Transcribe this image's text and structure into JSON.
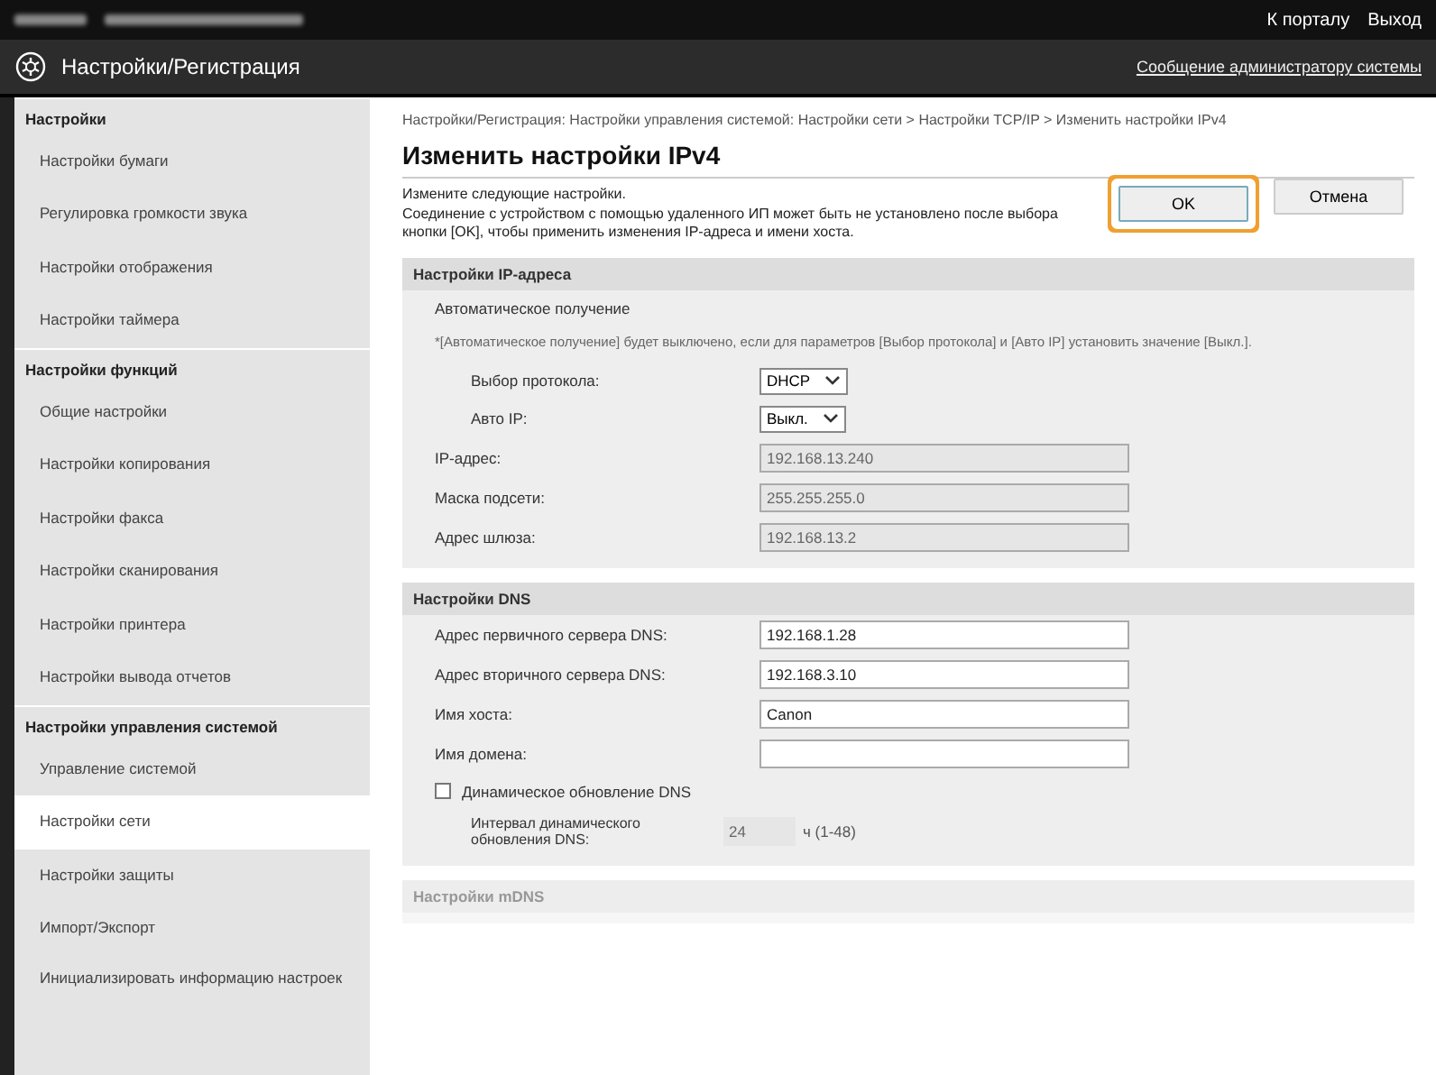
{
  "top_bar": {
    "links": [
      "К порталу",
      "Выход"
    ]
  },
  "header": {
    "title": "Настройки/Регистрация",
    "link": "Сообщение администратору системы"
  },
  "sidebar": {
    "groups": [
      {
        "title": "Настройки",
        "items": [
          {
            "label": "Настройки бумаги",
            "selected": false
          },
          {
            "label": "Регулировка громкости звука",
            "selected": false
          },
          {
            "label": "Настройки отображения",
            "selected": false
          },
          {
            "label": "Настройки таймера",
            "selected": false
          }
        ]
      },
      {
        "title": "Настройки функций",
        "items": [
          {
            "label": "Общие настройки",
            "selected": false
          },
          {
            "label": "Настройки копирования",
            "selected": false
          },
          {
            "label": "Настройки факса",
            "selected": false
          },
          {
            "label": "Настройки сканирования",
            "selected": false
          },
          {
            "label": "Настройки принтера",
            "selected": false
          },
          {
            "label": "Настройки вывода отчетов",
            "selected": false
          }
        ]
      },
      {
        "title": "Настройки управления системой",
        "items": [
          {
            "label": "Управление системой",
            "selected": false
          },
          {
            "label": "Настройки сети",
            "selected": true
          },
          {
            "label": "Настройки защиты",
            "selected": false
          },
          {
            "label": "Импорт/Экспорт",
            "selected": false
          },
          {
            "label": "Инициализировать информацию настроек",
            "selected": false
          }
        ]
      }
    ]
  },
  "breadcrumb": "Настройки/Регистрация: Настройки управления системой: Настройки сети > Настройки TCP/IP > Изменить настройки IPv4",
  "title": "Изменить настройки IPv4",
  "description": [
    "Измените следующие настройки.",
    "Соединение с устройством с помощью удаленного ИП может быть не установлено после выбора кнопки [OK], чтобы применить изменения IP-адреса и имени хоста."
  ],
  "buttons": [
    {
      "label": "OK",
      "highlighted": true
    },
    {
      "label": "Отмена",
      "highlighted": false
    }
  ],
  "sections": [
    {
      "title": "Настройки IP-адреса",
      "rows": [
        {
          "kind": "subheading",
          "label": "Автоматическое получение"
        },
        {
          "kind": "note",
          "label": "*[Автоматическое получение] будет выключено, если для параметров [Выбор протокола] и [Авто IP] установить значение [Выкл.]."
        },
        {
          "kind": "select",
          "label": "Выбор протокола:",
          "value": "DHCP",
          "indent": true
        },
        {
          "kind": "select",
          "label": "Авто IP:",
          "value": "Выкл.",
          "indent": true
        },
        {
          "kind": "readonly",
          "label": "IP-адрес:",
          "value": "192.168.13.240"
        },
        {
          "kind": "readonly",
          "label": "Маска подсети:",
          "value": "255.255.255.0"
        },
        {
          "kind": "readonly",
          "label": "Адрес шлюза:",
          "value": "192.168.13.2"
        }
      ]
    },
    {
      "title": "Настройки DNS",
      "rows": [
        {
          "kind": "text",
          "label": "Адрес первичного сервера DNS:",
          "value": "192.168.1.28"
        },
        {
          "kind": "text",
          "label": "Адрес вторичного сервера DNS:",
          "value": "192.168.3.10"
        },
        {
          "kind": "text",
          "label": "Имя хоста:",
          "value": "Canon"
        },
        {
          "kind": "text",
          "label": "Имя домена:"
        },
        {
          "kind": "checkbox",
          "label": "Динамическое обновление DNS",
          "checked": false
        },
        {
          "kind": "small",
          "label": "Интервал динамического обновления DNS:",
          "value": "24",
          "unit": "ч (1-48)",
          "indent": true
        }
      ]
    },
    {
      "title": "Настройки mDNS"
    }
  ]
}
